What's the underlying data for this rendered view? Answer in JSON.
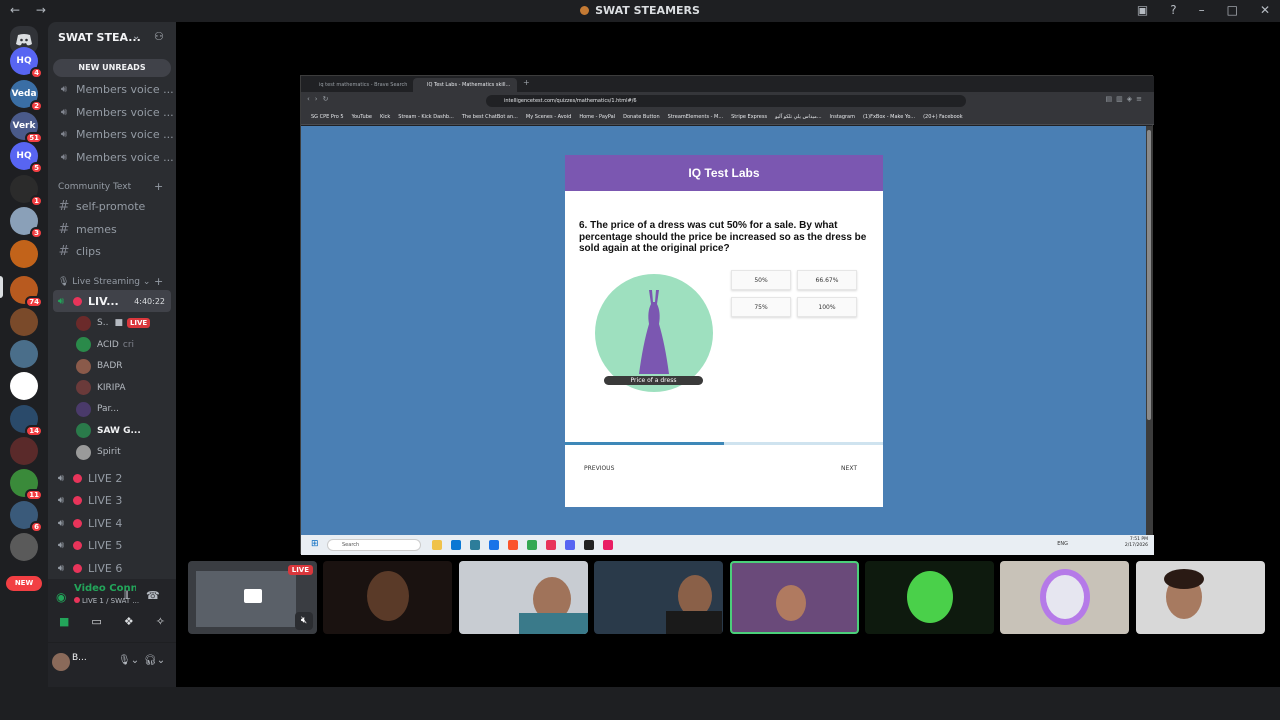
{
  "window": {
    "title": "SWAT STEAMERS",
    "nav_icons": "← →"
  },
  "servers": [
    {
      "badge": "4",
      "color": "#5865f2",
      "label": "HQ"
    },
    {
      "badge": "2",
      "color": "#3a6ea5",
      "label": "Veda"
    },
    {
      "badge": "51",
      "color": "#4a5a8a",
      "label": "Verk"
    },
    {
      "badge": "5",
      "color": "#5865f2",
      "label": "HQ"
    },
    {
      "badge": "1",
      "color": "#2b2b2b",
      "label": ""
    },
    {
      "badge": "3",
      "color": "#8aa0b8",
      "label": ""
    },
    {
      "badge": "",
      "color": "#c2631a",
      "label": ""
    },
    {
      "badge": "74",
      "color": "#b85a1f",
      "label": ""
    },
    {
      "badge": "",
      "color": "#7a4a2a",
      "label": ""
    },
    {
      "badge": "",
      "color": "#4a6e8a",
      "label": ""
    },
    {
      "badge": "",
      "color": "#ffffff",
      "label": ""
    },
    {
      "badge": "14",
      "color": "#2a4a6a",
      "label": ""
    },
    {
      "badge": "",
      "color": "#5a2a2a",
      "label": ""
    },
    {
      "badge": "11",
      "color": "#3a8a3a",
      "label": ""
    },
    {
      "badge": "6",
      "color": "#3a5a7a",
      "label": ""
    },
    {
      "badge": "",
      "color": "#5a5a5a",
      "label": ""
    }
  ],
  "new_pill": "NEW",
  "guild": {
    "name": "SWAT STEA...",
    "new_unreads": "NEW UNREADS"
  },
  "voice_members": [
    "Members voice ...",
    "Members voice ...",
    "Members voice ...",
    "Members voice ..."
  ],
  "community_text": {
    "category": "Community Text",
    "channels": [
      "self-promote",
      "memes",
      "clips"
    ]
  },
  "live_streaming": {
    "category": "Live Streaming",
    "active_channel": "LIV...",
    "timer": "4:40:22",
    "users": [
      {
        "name": "S..",
        "live": "LIVE",
        "color": "#6b2a2a"
      },
      {
        "name": "ACID",
        "extra": "cri",
        "color": "#2a8a4a"
      },
      {
        "name": "BADR",
        "color": "#8a5a4a"
      },
      {
        "name": "KIRIPA",
        "color": "#6a3a3a"
      },
      {
        "name": "Par...",
        "color": "#4a3a6a"
      },
      {
        "name": "SAW G...",
        "color": "#2a7a4a"
      },
      {
        "name": "Spirit",
        "color": "#9a9a9a"
      }
    ],
    "channels": [
      "LIVE 2",
      "LIVE 3",
      "LIVE 4",
      "LIVE 5",
      "LIVE 6"
    ]
  },
  "voice_panel": {
    "status": "Video Connecte",
    "channel": "LIVE 1 / SWAT ..."
  },
  "user_panel": {
    "name": "B..."
  },
  "browser": {
    "tabs": [
      "iq test mathematics - Brave Search",
      "IQ Test Labs - Mathematics skill..."
    ],
    "url": "intelligencetest.com/quizzes/mathematics/1.html#/6",
    "bookmarks": [
      "SG CPE Pro 5",
      "YouTube",
      "Kick",
      "Stream - Kick Dashb...",
      "The best ChatBot an...",
      "My Scenes - Avoid",
      "Home - PayPal",
      "Donate Button",
      "StreamElements - M...",
      "Stripe Express",
      "ميداس يلي تلكو آليو...",
      "Instagram",
      "(1)FxBox - Make Yo...",
      "(20+) Facebook"
    ]
  },
  "quiz": {
    "header": "IQ Test Labs",
    "question": "6. The price of a dress was cut 50% for a sale. By what percentage should the price be increased so as the dress be sold again at the original price?",
    "image_label": "Price of a dress",
    "options": [
      "50%",
      "66.67%",
      "75%",
      "100%"
    ],
    "progress": 0.5,
    "previous": "PREVIOUS",
    "next": "NEXT",
    "colors": {
      "header": "#7b57b1",
      "background": "#4a7fb4",
      "progress": "#3e88b8"
    }
  },
  "taskbar": {
    "search": "Search",
    "lang": "ENG",
    "time": "7:51 PM",
    "date": "2/17/2026"
  },
  "thumbnails": [
    {
      "live": "LIVE"
    },
    {},
    {},
    {},
    {
      "selected": true
    },
    {},
    {},
    {}
  ]
}
